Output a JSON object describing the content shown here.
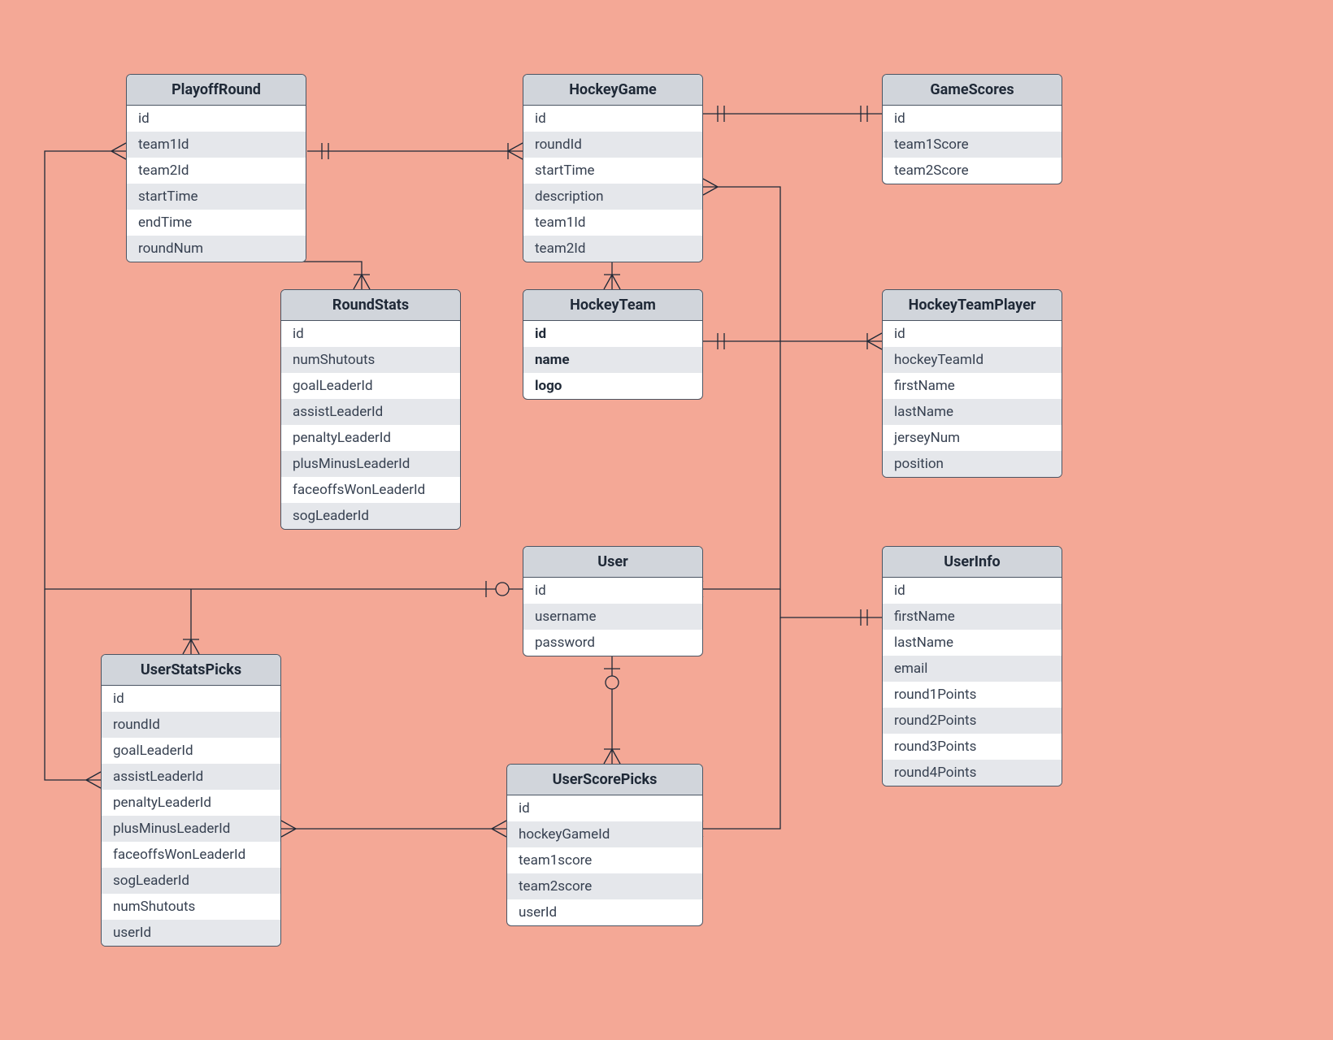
{
  "entities": {
    "PlayoffRound": {
      "title": "PlayoffRound",
      "fields": [
        "id",
        "team1Id",
        "team2Id",
        "startTime",
        "endTime",
        "roundNum"
      ]
    },
    "HockeyGame": {
      "title": "HockeyGame",
      "fields": [
        "id",
        "roundId",
        "startTime",
        "description",
        "team1Id",
        "team2Id"
      ]
    },
    "GameScores": {
      "title": "GameScores",
      "fields": [
        "id",
        "team1Score",
        "team2Score"
      ]
    },
    "RoundStats": {
      "title": "RoundStats",
      "fields": [
        "id",
        "numShutouts",
        "goalLeaderId",
        "assistLeaderId",
        "penaltyLeaderId",
        "plusMinusLeaderId",
        "faceoffsWonLeaderId",
        "sogLeaderId"
      ]
    },
    "HockeyTeam": {
      "title": "HockeyTeam",
      "boldFields": true,
      "fields": [
        "id",
        "name",
        "logo"
      ]
    },
    "HockeyTeamPlayer": {
      "title": "HockeyTeamPlayer",
      "fields": [
        "id",
        "hockeyTeamId",
        "firstName",
        "lastName",
        "jerseyNum",
        "position"
      ]
    },
    "User": {
      "title": "User",
      "fields": [
        "id",
        "username",
        "password"
      ]
    },
    "UserInfo": {
      "title": "UserInfo",
      "fields": [
        "id",
        "firstName",
        "lastName",
        "email",
        "round1Points",
        "round2Points",
        "round3Points",
        "round4Points"
      ]
    },
    "UserStatsPicks": {
      "title": "UserStatsPicks",
      "fields": [
        "id",
        "roundId",
        "goalLeaderId",
        "assistLeaderId",
        "penaltyLeaderId",
        "plusMinusLeaderId",
        "faceoffsWonLeaderId",
        "sogLeaderId",
        "numShutouts",
        "userId"
      ]
    },
    "UserScorePicks": {
      "title": "UserScorePicks",
      "fields": [
        "id",
        "hockeyGameId",
        "team1score",
        "team2score",
        "userId"
      ]
    }
  }
}
